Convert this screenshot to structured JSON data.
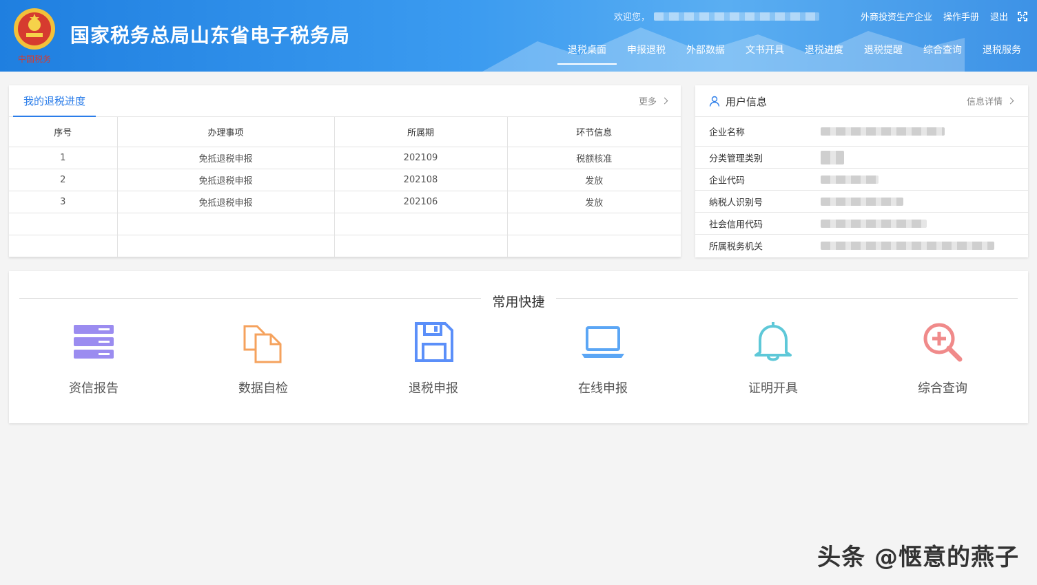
{
  "header": {
    "title": "国家税务总局山东省电子税务局",
    "emblem_text": "中国税务",
    "welcome": "欢迎您，",
    "links": [
      "外商投资生产企业",
      "操作手册",
      "退出"
    ],
    "nav": [
      "退税桌面",
      "申报退税",
      "外部数据",
      "文书开具",
      "退税进度",
      "退税提醒",
      "综合查询",
      "退税服务"
    ],
    "active_nav": "退税桌面"
  },
  "progress": {
    "tab": "我的退税进度",
    "more": "更多",
    "columns": [
      "序号",
      "办理事项",
      "所属期",
      "环节信息"
    ],
    "rows": [
      [
        "1",
        "免抵退税申报",
        "202109",
        "税额核准"
      ],
      [
        "2",
        "免抵退税申报",
        "202108",
        "发放"
      ],
      [
        "3",
        "免抵退税申报",
        "202106",
        "发放"
      ],
      [
        "",
        "",
        "",
        ""
      ],
      [
        "",
        "",
        "",
        ""
      ]
    ]
  },
  "user": {
    "title": "用户信息",
    "more": "信息详情",
    "fields": [
      "企业名称",
      "分类管理类别",
      "企业代码",
      "纳税人识别号",
      "社会信用代码",
      "所属税务机关"
    ]
  },
  "shortcuts": {
    "title": "常用快捷",
    "items": [
      {
        "label": "资信报告",
        "icon": "server-icon",
        "color": "#9b8cf0"
      },
      {
        "label": "数据自检",
        "icon": "documents-icon",
        "color": "#f5a25d"
      },
      {
        "label": "退税申报",
        "icon": "save-icon",
        "color": "#5b8ff9"
      },
      {
        "label": "在线申报",
        "icon": "laptop-icon",
        "color": "#5ba6f5"
      },
      {
        "label": "证明开具",
        "icon": "bell-icon",
        "color": "#5ec8d8"
      },
      {
        "label": "综合查询",
        "icon": "zoom-in-icon",
        "color": "#f08a8a"
      }
    ]
  },
  "watermark": "头条 @惬意的燕子"
}
